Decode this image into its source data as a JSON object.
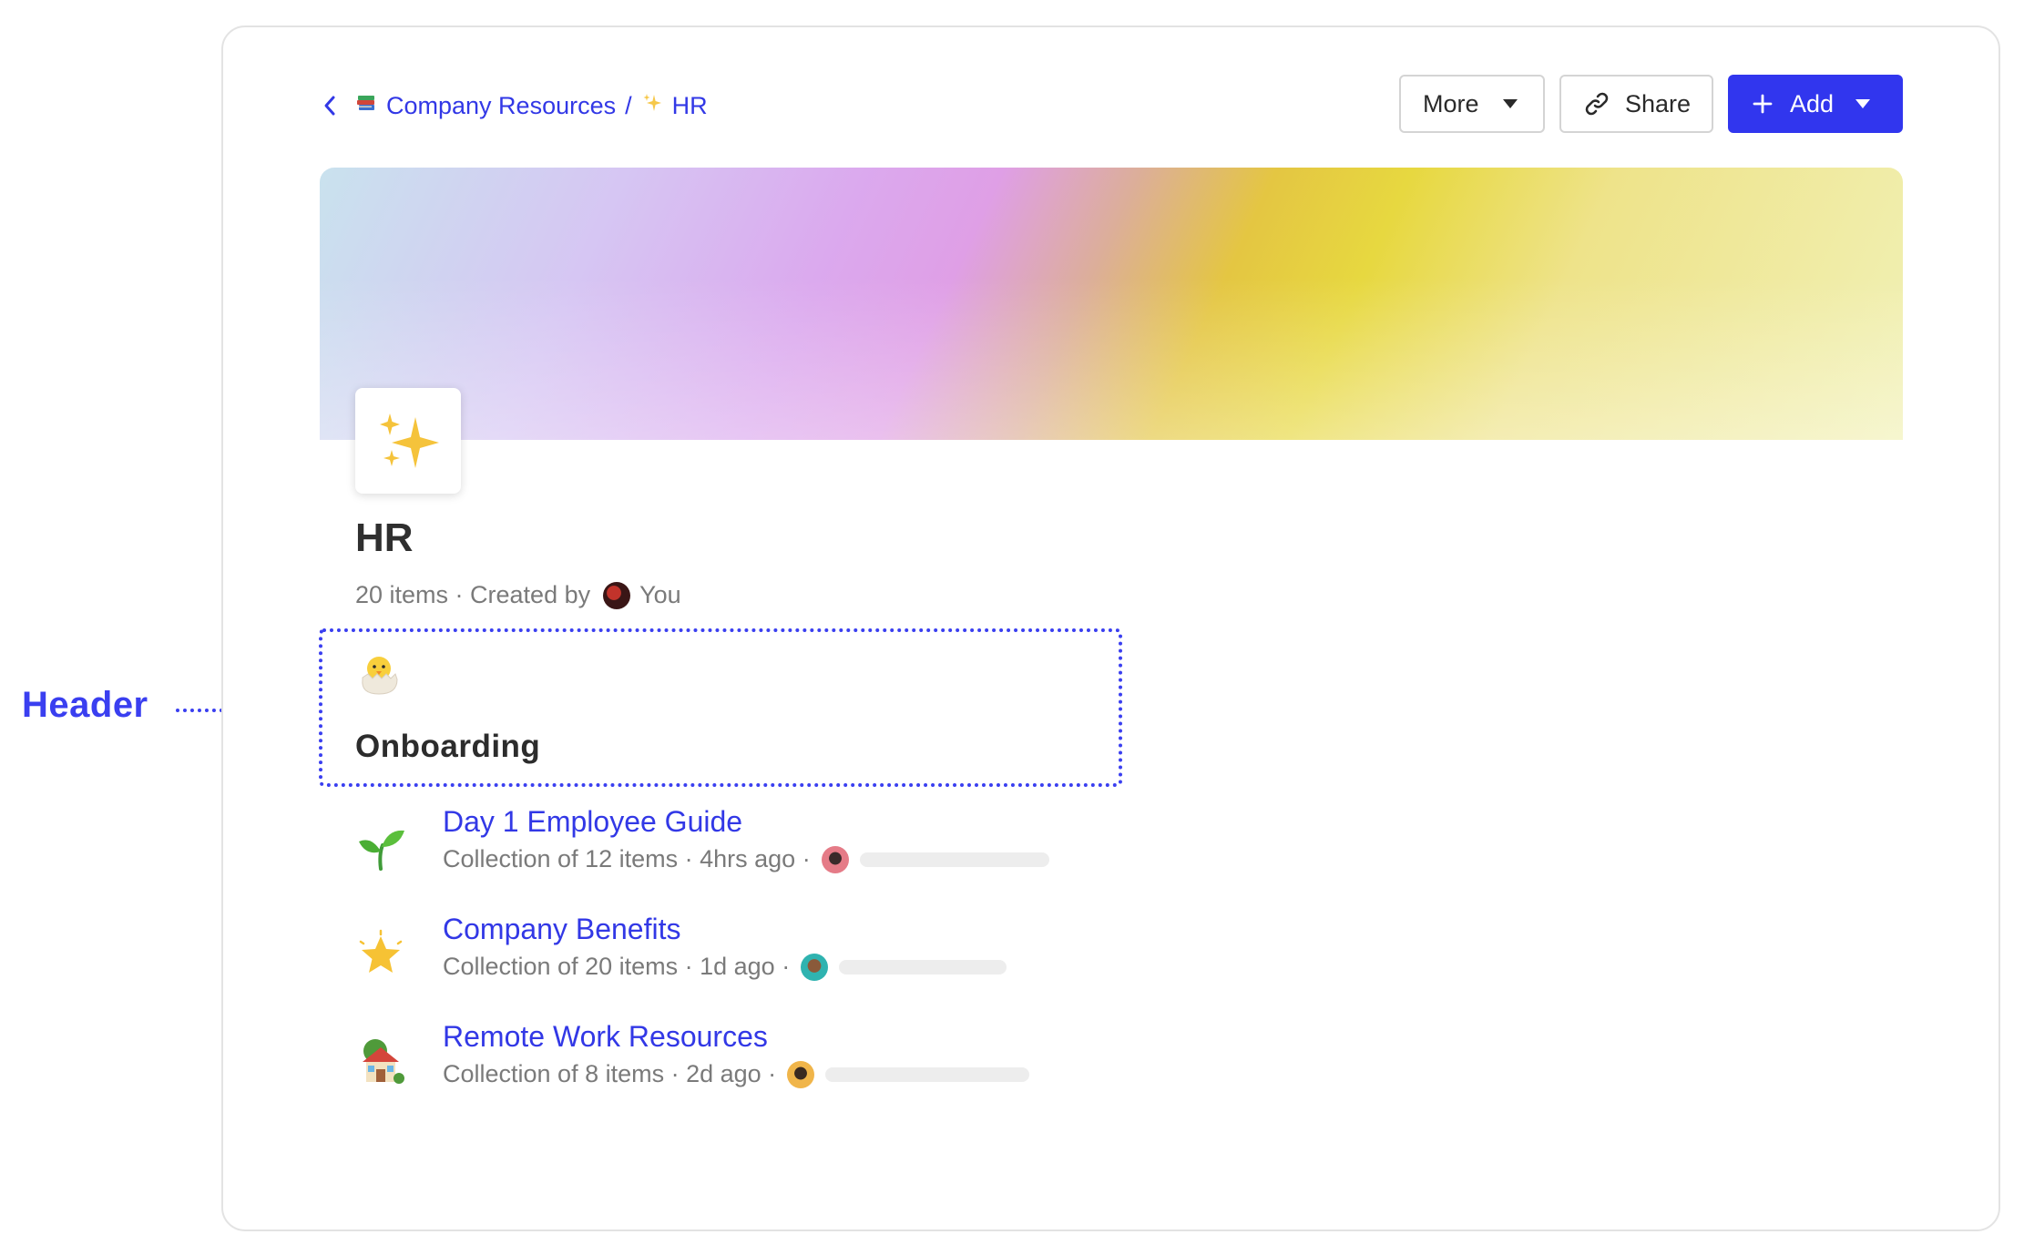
{
  "annotation": {
    "label": "Header"
  },
  "breadcrumb": {
    "parent": "Company Resources",
    "separator": "/",
    "current": "HR",
    "parent_icon": "books-emoji-icon",
    "current_icon": "sparkles-emoji-icon"
  },
  "toolbar": {
    "more_label": "More",
    "share_label": "Share",
    "add_label": "Add"
  },
  "page": {
    "icon": "sparkles-emoji-icon",
    "title": "HR",
    "meta_count": "20 items · Created by",
    "meta_creator": "You"
  },
  "section_header": {
    "icon": "hatching-chick-emoji-icon",
    "title": "Onboarding"
  },
  "items": [
    {
      "icon": "seedling-emoji-icon",
      "title": "Day 1 Employee Guide",
      "subtitle": "Collection of 12 items · 4hrs ago ·"
    },
    {
      "icon": "glowing-star-emoji-icon",
      "title": "Company Benefits",
      "subtitle": "Collection of 20 items · 1d ago ·"
    },
    {
      "icon": "house-with-garden-emoji-icon",
      "title": "Remote Work Resources",
      "subtitle": "Collection of 8 items · 2d ago ·"
    }
  ],
  "colors": {
    "accent": "#3136ee",
    "link": "#3238e6",
    "annotation": "#3a3ff0"
  }
}
